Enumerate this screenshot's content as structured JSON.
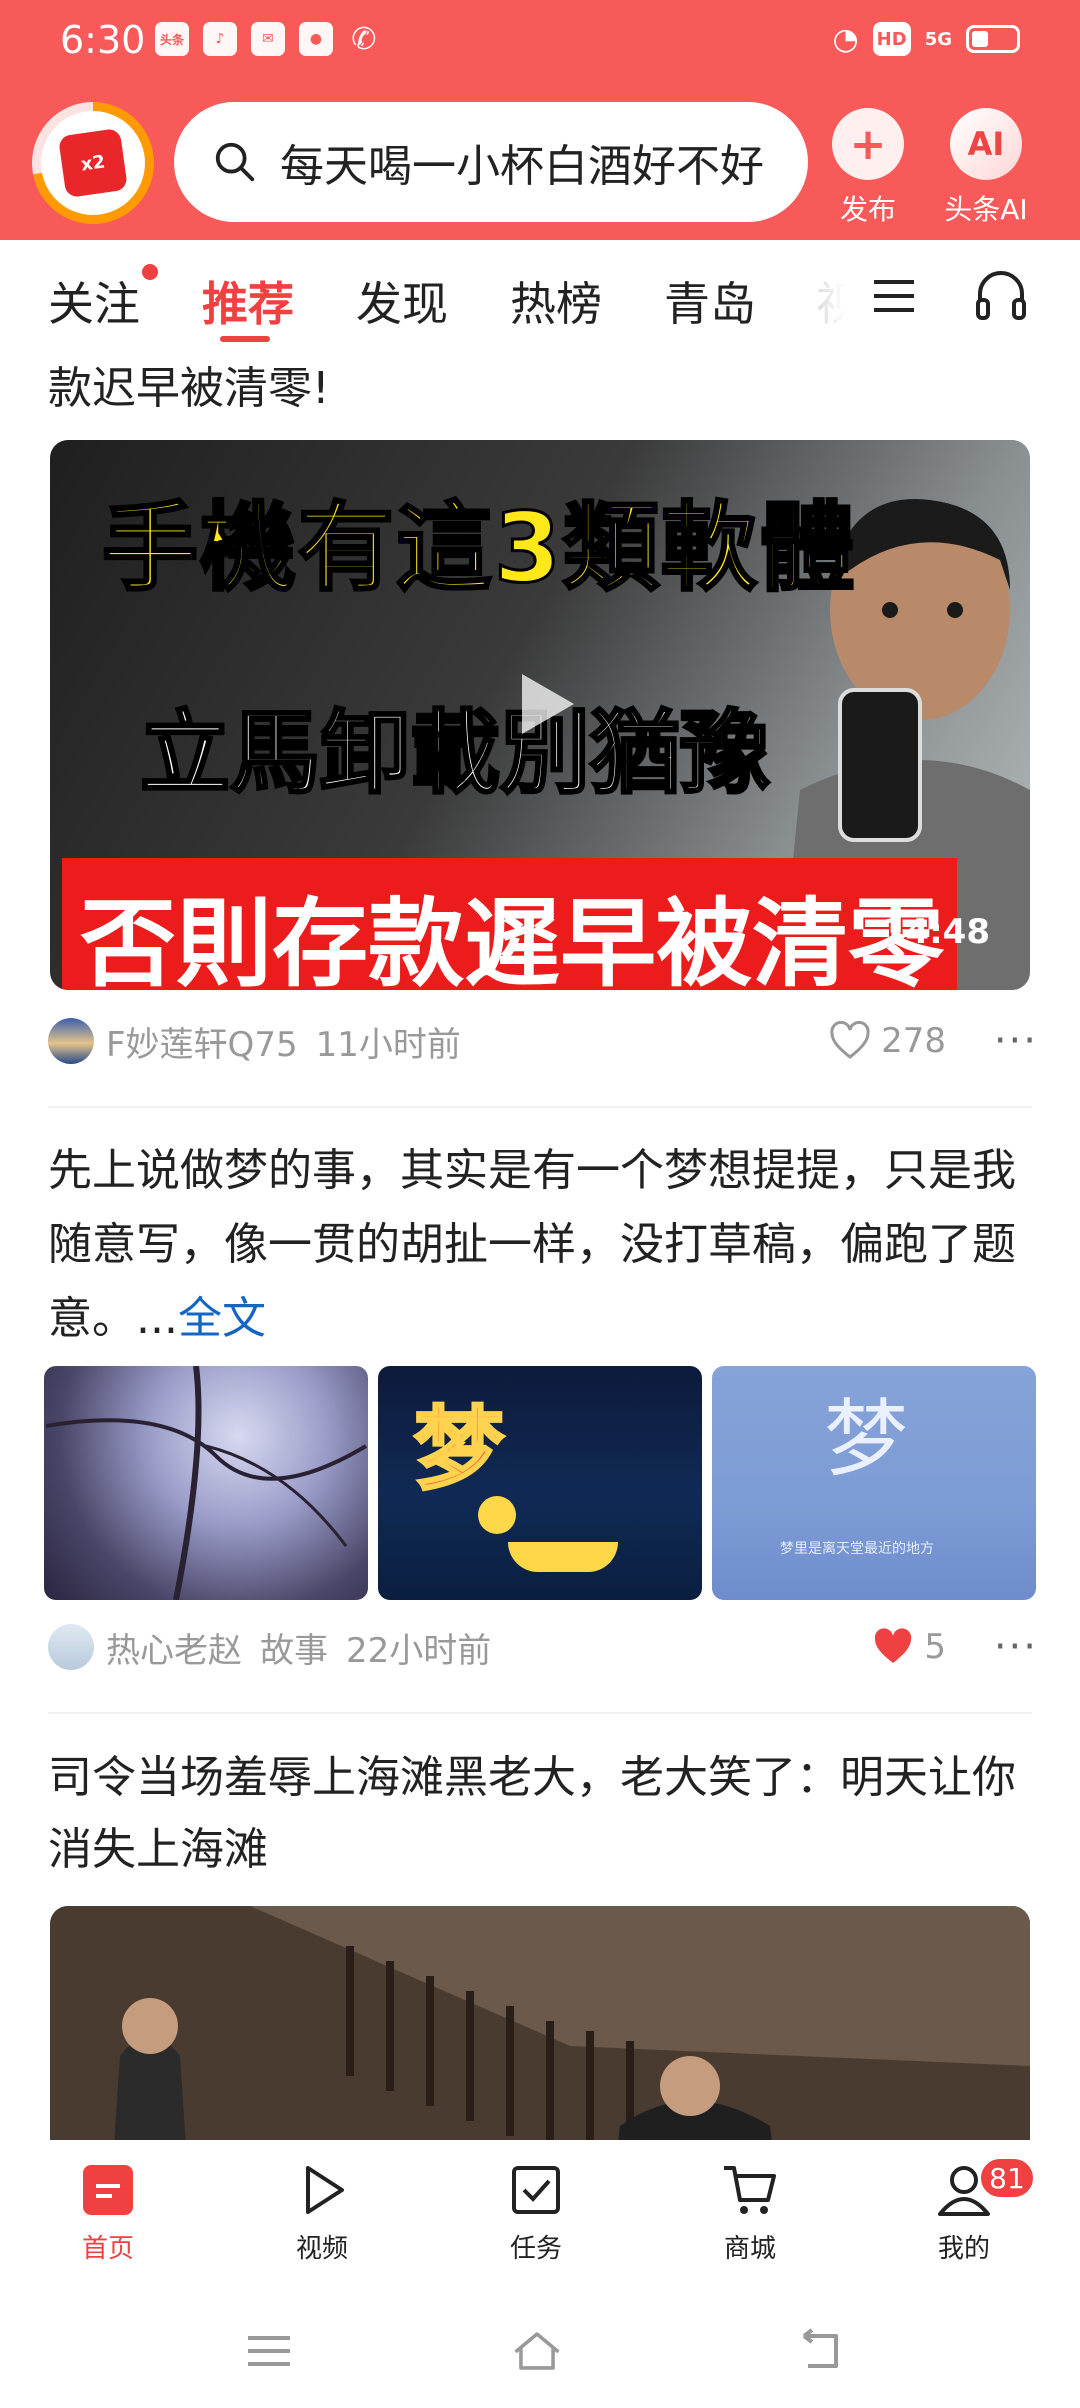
{
  "status_bar": {
    "time": "6:30",
    "app_icons": [
      "头条",
      "抖音",
      "邮件",
      "消息",
      "电话"
    ],
    "right_icons": [
      "HD",
      "5G"
    ]
  },
  "header": {
    "avatar_badge": "x2",
    "search_text": "每天喝一小杯白酒好不好",
    "publish_label": "发布",
    "ai_label": "头条AI",
    "ai_icon_text": "AI",
    "accent_color": "#f85959"
  },
  "tabs": [
    "关注",
    "推荐",
    "发现",
    "热榜",
    "青岛",
    "视"
  ],
  "feed": {
    "post1": {
      "title_tail": "款迟早被清零!",
      "video_text_line1": "手機有這3類軟體",
      "video_text_line2": "立馬卸載別猶豫",
      "video_text_line3": "否則存款遲早被清零",
      "duration": "14:48",
      "author": "F妙莲轩Q75",
      "time": "11小时前",
      "likes": "278"
    },
    "post2": {
      "body": "先上说做梦的事，其实是有一个梦想提提，只是我随意写，像一贯的胡扯一样，没打草稿，偏跑了题意。...",
      "full_link": "全文",
      "thumb2_text": "梦",
      "thumb3_text": "梦",
      "thumb3_caption": "梦里是离天堂最近的地方",
      "author": "热心老赵",
      "category": "故事",
      "time": "22小时前",
      "likes": "5"
    },
    "post3": {
      "title": "司令当场羞辱上海滩黑老大，老大笑了：明天让你消失上海滩"
    }
  },
  "bottom_nav": [
    {
      "label": "首页",
      "icon": "home-icon",
      "active": true
    },
    {
      "label": "视频",
      "icon": "video-icon"
    },
    {
      "label": "任务",
      "icon": "task-icon"
    },
    {
      "label": "商城",
      "icon": "cart-icon"
    },
    {
      "label": "我的",
      "icon": "profile-icon",
      "badge": "81"
    }
  ]
}
